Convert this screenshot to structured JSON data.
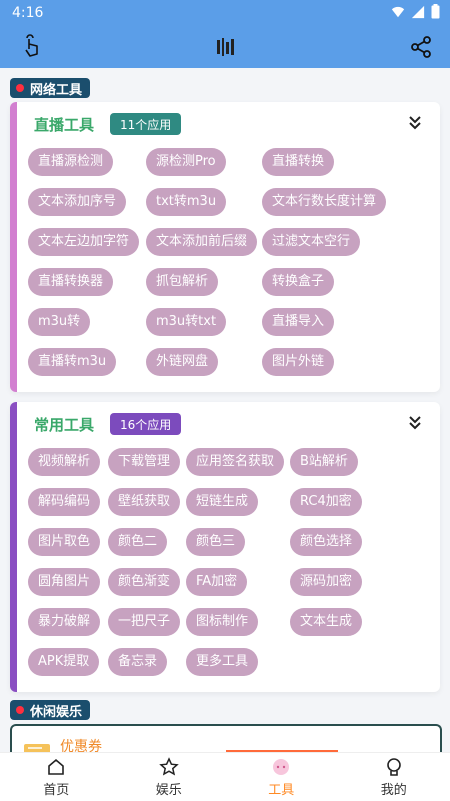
{
  "status": {
    "time": "4:16"
  },
  "sections": {
    "network": "网络工具",
    "leisure": "休闲娱乐"
  },
  "live": {
    "title": "直播工具",
    "count": "11个应用",
    "accent": "#d27fd0",
    "badge_color": "#2f8a82",
    "chips": [
      "直播源检测",
      "源检测Pro",
      "直播转换",
      "文本添加序号",
      "txt转m3u",
      "文本行数长度计算",
      "文本左边加字符",
      "文本添加前后缀",
      "过滤文本空行",
      "直播转换器",
      "抓包解析",
      "转换盒子",
      "m3u转",
      "m3u转txt",
      "直播导入",
      "直播转m3u",
      "外链网盘",
      "图片外链"
    ]
  },
  "common": {
    "title": "常用工具",
    "count": "16个应用",
    "accent": "#8a4fc2",
    "badge_color": "#7c4bbd",
    "chips": [
      "视频解析",
      "下载管理",
      "应用签名获取",
      "B站解析",
      "解码编码",
      "壁纸获取",
      "短链生成",
      "RC4加密",
      "图片取色",
      "颜色二",
      "颜色三",
      "颜色选择",
      "圆角图片",
      "颜色渐变",
      "FA加密",
      "源码加密",
      "暴力破解",
      "一把尺子",
      "图标制作",
      "文本生成",
      "APK提取",
      "备忘录",
      "更多工具"
    ]
  },
  "coupon": {
    "label": "优惠券"
  },
  "tabs": [
    {
      "label": "首页",
      "icon": "home-icon"
    },
    {
      "label": "娱乐",
      "icon": "star-icon"
    },
    {
      "label": "工具",
      "icon": "tools-icon"
    },
    {
      "label": "我的",
      "icon": "profile-icon"
    }
  ],
  "colors": {
    "primary": "#5b9ee8",
    "chip": "#c7a2c0",
    "active_tab": "#ff8a24"
  }
}
